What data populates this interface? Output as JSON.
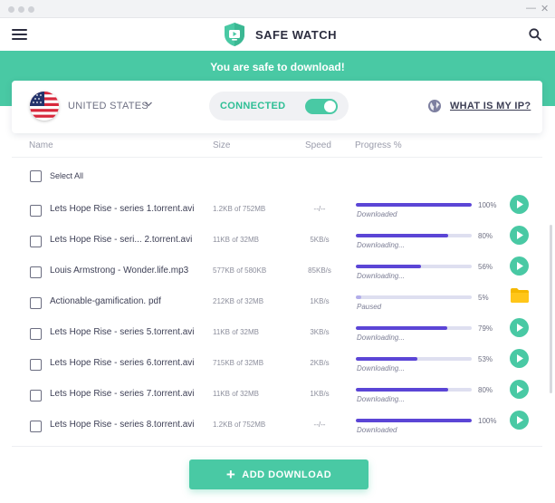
{
  "app": {
    "title": "SAFE WATCH"
  },
  "banner": {
    "text": "You are safe to download!"
  },
  "status": {
    "country": "UNITED STATES",
    "connection_label": "CONNECTED",
    "connected": true,
    "ip_link": "WHAT IS MY IP?"
  },
  "table": {
    "headers": {
      "name": "Name",
      "size": "Size",
      "speed": "Speed",
      "progress": "Progress %"
    },
    "select_all": "Select All",
    "rows": [
      {
        "name": "Lets Hope Rise - series 1.torrent.avi",
        "size": "1.2KB of 752MB",
        "speed": "--/--",
        "progress": 100,
        "pct_label": "100%",
        "status": "Downloaded",
        "action": "play-icon"
      },
      {
        "name": "Lets Hope Rise - seri... 2.torrent.avi",
        "size": "11KB of 32MB",
        "speed": "5KB/s",
        "progress": 80,
        "pct_label": "80%",
        "status": "Downloading...",
        "action": "play-icon"
      },
      {
        "name": "Louis Armstrong - Wonder.life.mp3",
        "size": "577KB of 580KB",
        "speed": "85KB/s",
        "progress": 56,
        "pct_label": "56%",
        "status": "Downloading...",
        "action": "play-icon"
      },
      {
        "name": "Actionable-gamification. pdf",
        "size": "212KB of 32MB",
        "speed": "1KB/s",
        "progress": 5,
        "pct_label": "5%",
        "status": "Paused",
        "action": "folder-icon"
      },
      {
        "name": "Lets Hope Rise - series 5.torrent.avi",
        "size": "11KB of 32MB",
        "speed": "3KB/s",
        "progress": 79,
        "pct_label": "79%",
        "status": "Downloading...",
        "action": "play-icon"
      },
      {
        "name": "Lets Hope Rise - series 6.torrent.avi",
        "size": "715KB of 32MB",
        "speed": "2KB/s",
        "progress": 53,
        "pct_label": "53%",
        "status": "Downloading...",
        "action": "play-icon"
      },
      {
        "name": "Lets Hope Rise - series 7.torrent.avi",
        "size": "11KB of 32MB",
        "speed": "1KB/s",
        "progress": 80,
        "pct_label": "80%",
        "status": "Downloading...",
        "action": "play-icon"
      },
      {
        "name": "Lets Hope Rise - series 8.torrent.avi",
        "size": "1.2KB of 752MB",
        "speed": "--/--",
        "progress": 100,
        "pct_label": "100%",
        "status": "Downloaded",
        "action": "play-icon"
      }
    ]
  },
  "footer": {
    "add_button": "ADD DOWNLOAD"
  },
  "colors": {
    "accent": "#49c9a4",
    "progress_active": "#5b45d6",
    "progress_paused": "#b3aeea",
    "folder": "#f5b800"
  }
}
